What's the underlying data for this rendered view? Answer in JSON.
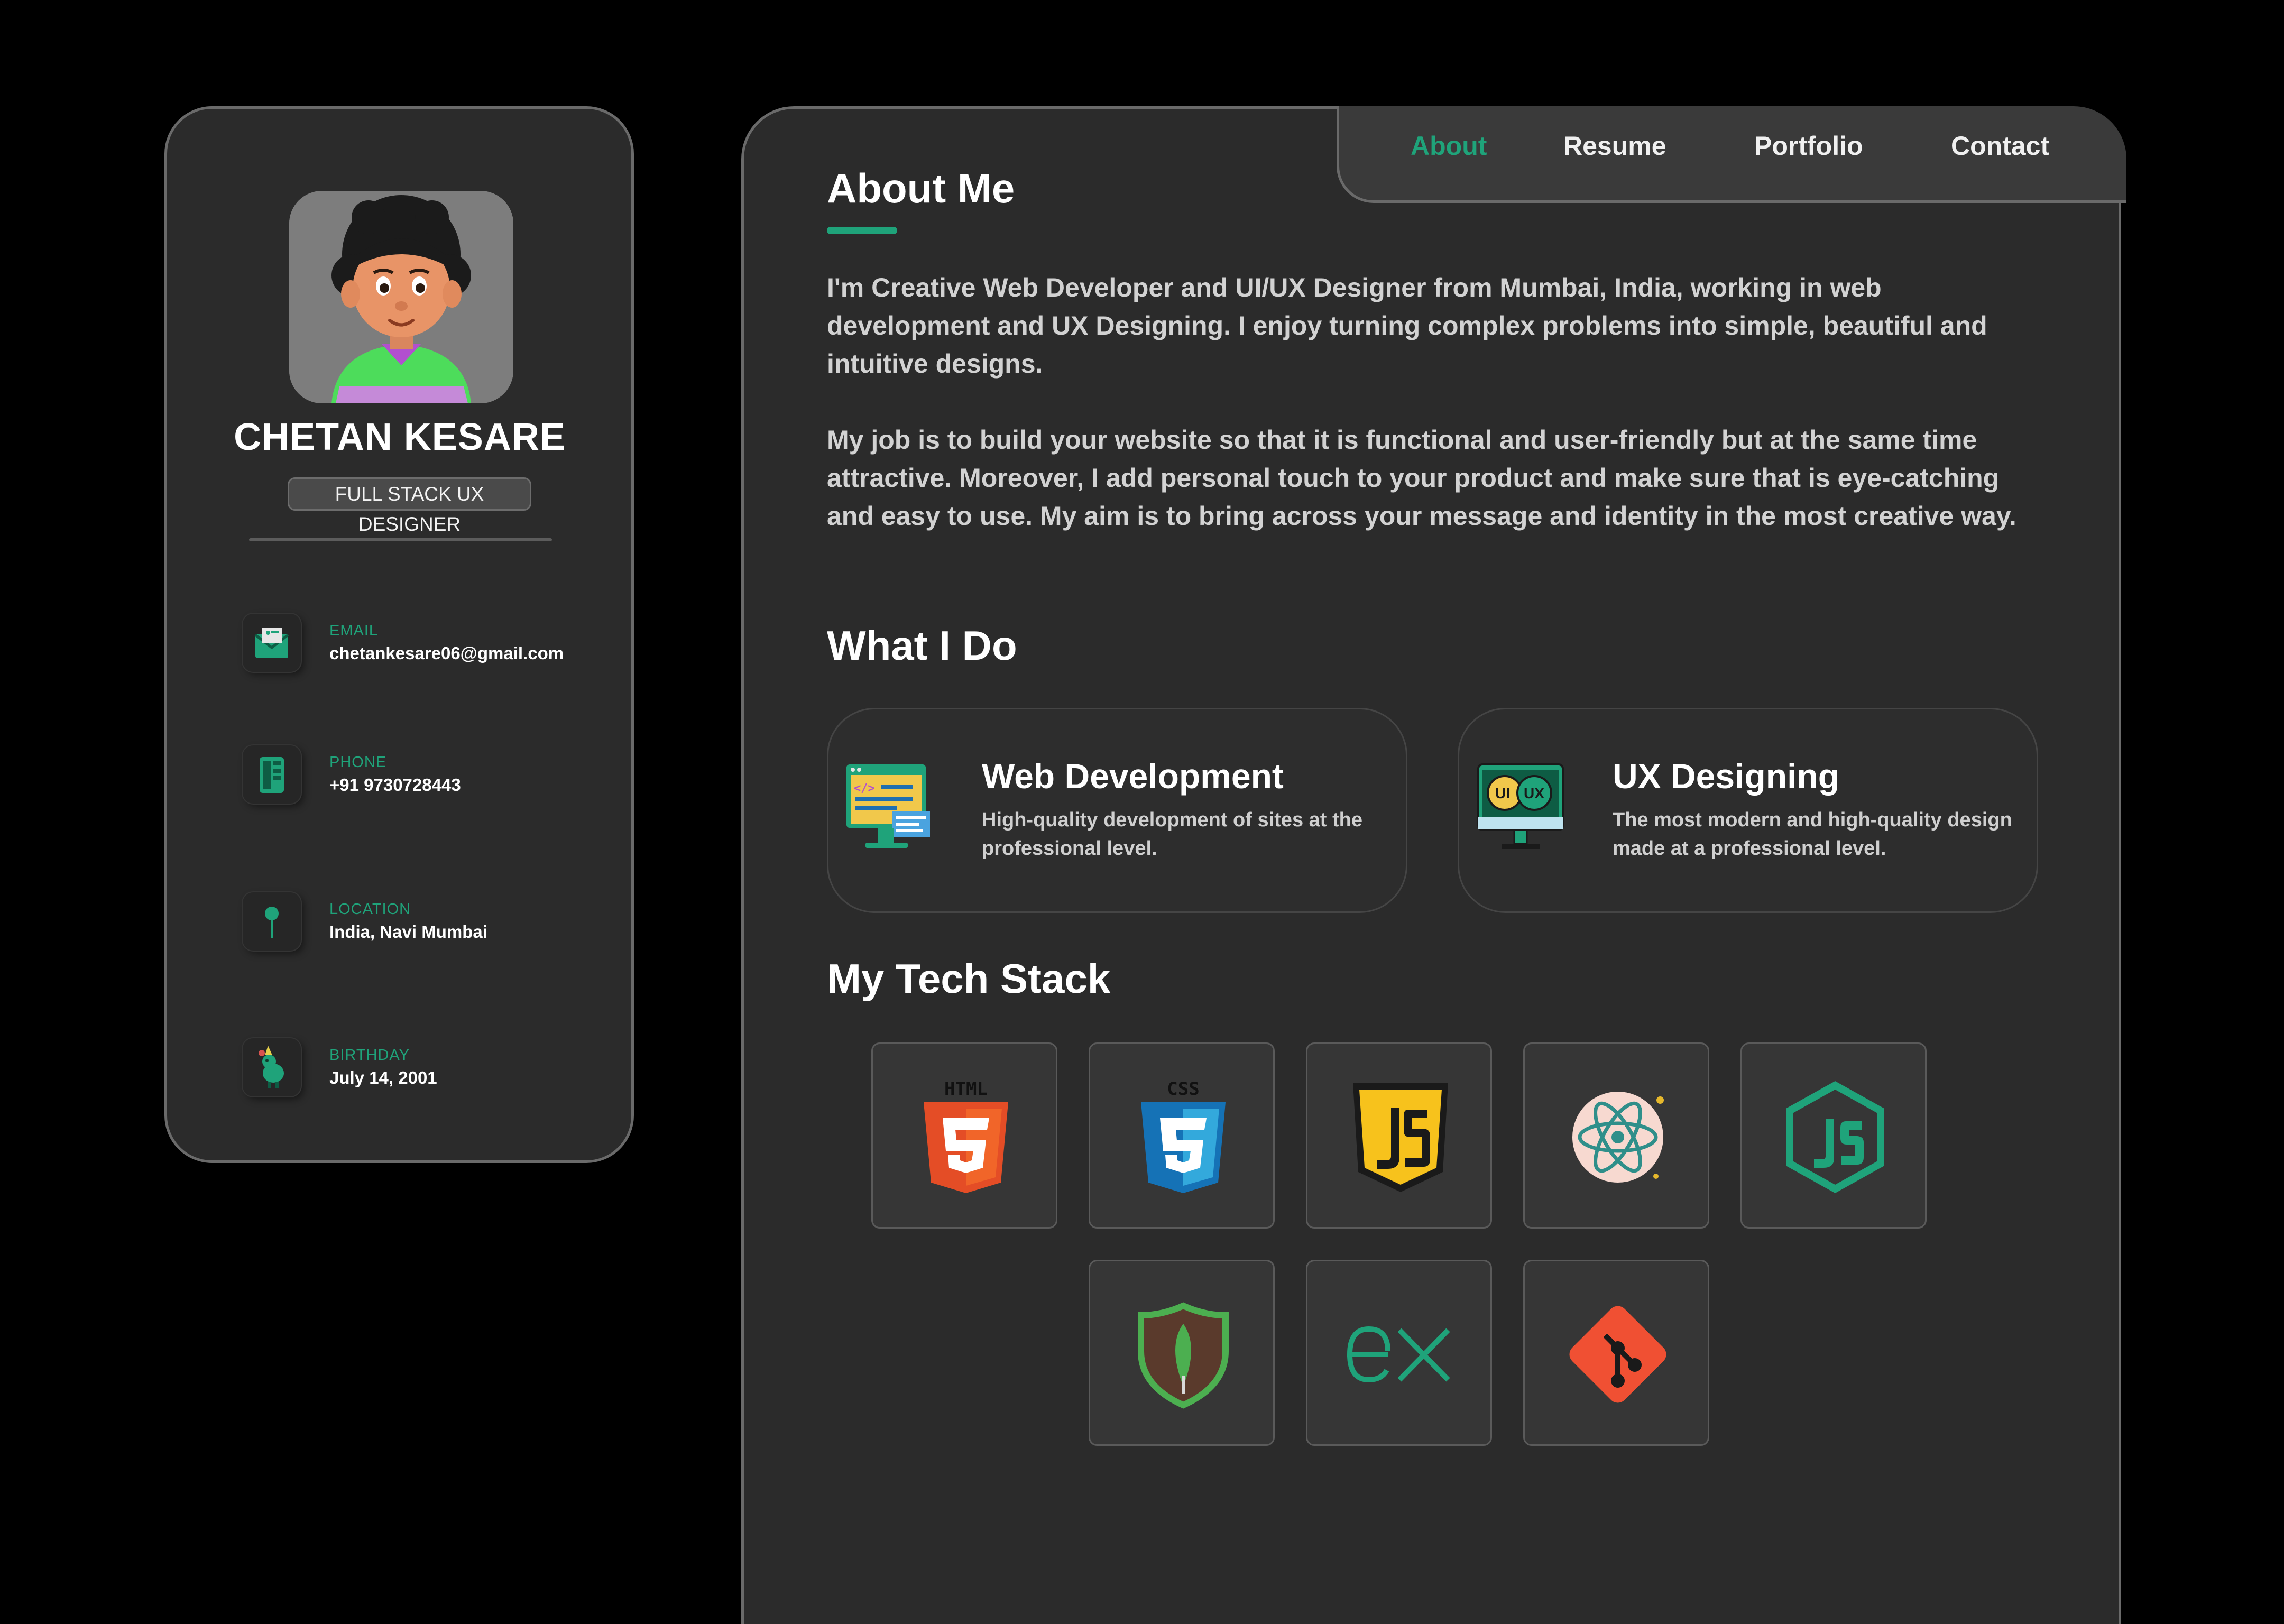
{
  "sidebar": {
    "name": "CHETAN KESARE",
    "role": "FULL STACK UX DESIGNER",
    "contacts": [
      {
        "label": "EMAIL",
        "value": "chetankesare06@gmail.com",
        "icon": "email-icon"
      },
      {
        "label": "PHONE",
        "value": "+91  9730728443",
        "icon": "phone-icon"
      },
      {
        "label": "LOCATION",
        "value": "India, Navi Mumbai",
        "icon": "location-pin-icon"
      },
      {
        "label": "BIRTHDAY",
        "value": "July 14, 2001",
        "icon": "birthday-icon"
      }
    ]
  },
  "nav": {
    "items": [
      {
        "label": "About",
        "active": true
      },
      {
        "label": "Resume"
      },
      {
        "label": "Portfolio"
      },
      {
        "label": "Contact"
      }
    ]
  },
  "about": {
    "title": "About Me",
    "paragraphs": [
      "I'm Creative Web Developer and UI/UX Designer from Mumbai, India, working in web development and UX Designing. I enjoy turning complex problems into simple, beautiful and intuitive designs.",
      "My job is to build your website so that it is functional and user-friendly but at the same time attractive. Moreover, I add personal touch to your product and make sure that is eye-catching and easy to use. My aim is to bring across your message and identity in the most creative way."
    ]
  },
  "services": {
    "title": "What I Do",
    "items": [
      {
        "title": "Web Development",
        "desc": "High-quality development of sites at the professional level.",
        "icon": "web-development-icon"
      },
      {
        "title": "UX Designing",
        "desc": "The most modern and high-quality design made at a professional level.",
        "icon": "ux-design-icon",
        "icon_text": [
          "UI",
          "UX"
        ]
      }
    ]
  },
  "tech": {
    "title": "My Tech Stack",
    "html_label": "HTML",
    "css_label": "CSS",
    "items": [
      "html5-icon",
      "css3-icon",
      "javascript-icon",
      "react-icon",
      "nodejs-icon",
      "mongodb-icon",
      "express-icon",
      "git-icon"
    ]
  },
  "colors": {
    "accent": "#1fa37a",
    "background": "#000000",
    "card": "#2b2b2b"
  }
}
